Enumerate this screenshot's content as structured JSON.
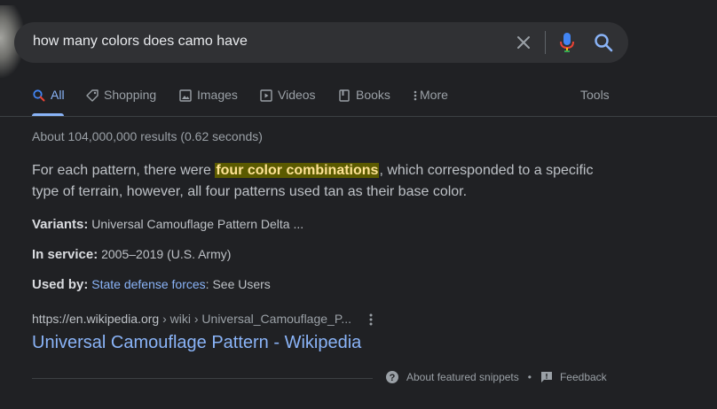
{
  "search": {
    "query": "how many colors does camo have"
  },
  "tabs": [
    {
      "label": "All",
      "icon": "search-icon",
      "active": true
    },
    {
      "label": "Shopping",
      "icon": "tag-icon"
    },
    {
      "label": "Images",
      "icon": "image-icon"
    },
    {
      "label": "Videos",
      "icon": "video-icon"
    },
    {
      "label": "Books",
      "icon": "book-icon"
    },
    {
      "label": "More",
      "icon": "more-vertical-icon"
    }
  ],
  "tools_label": "Tools",
  "stats": "About 104,000,000 results (0.62 seconds)",
  "snippet": {
    "before": "For each pattern, there were ",
    "highlight": "four color combinations",
    "after": ", which corresponded to a specific type of terrain, however, all four patterns used tan as their base color."
  },
  "facts": [
    {
      "key": "Variants:",
      "value": "Universal Camouflage Pattern Delta ..."
    },
    {
      "key": "In service:",
      "value": "2005–2019 (U.S. Army)"
    },
    {
      "key": "Used by:",
      "link": "State defense forces",
      "value": ": See Users"
    }
  ],
  "result": {
    "domain": "https://en.wikipedia.org",
    "path": " › wiki › Universal_Camouflage_P...",
    "title": "Universal Camouflage Pattern - Wikipedia"
  },
  "footer": {
    "about_label": "About featured snippets",
    "separator": "•",
    "feedback_label": "Feedback"
  },
  "colors": {
    "background": "#202124",
    "search_box": "#303134",
    "link": "#8ab4f8",
    "highlight_bg": "#5b5a00",
    "highlight_text": "#fde293"
  }
}
